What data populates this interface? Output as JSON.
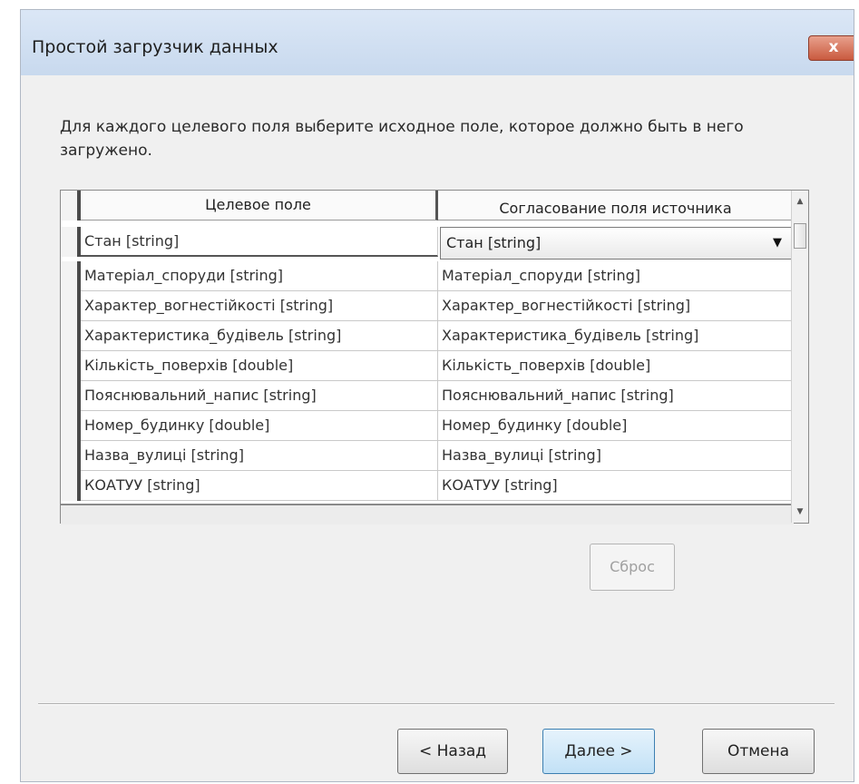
{
  "window": {
    "title": "Простой загрузчик данных",
    "close_label": "x"
  },
  "instructions": "Для каждого целевого поля выберите исходное поле, которое должно быть в него загружено.",
  "grid": {
    "columns": [
      "Целевое поле",
      "Согласование поля источника"
    ],
    "selected_row": {
      "target": "Стан [string]",
      "source_dropdown_value": "Стан [string]"
    },
    "rows": [
      {
        "target": "Матеріал_споруди [string]",
        "source": "Матеріал_споруди [string]"
      },
      {
        "target": "Характер_вогнестійкості [string]",
        "source": "Характер_вогнестійкості [string]"
      },
      {
        "target": "Характеристика_будівель [string]",
        "source": "Характеристика_будівель [string]"
      },
      {
        "target": "Кількість_поверхів [double]",
        "source": "Кількість_поверхів [double]"
      },
      {
        "target": "Пояснювальний_напис [string]",
        "source": "Пояснювальний_напис [string]"
      },
      {
        "target": "Номер_будинку [double]",
        "source": "Номер_будинку [double]"
      },
      {
        "target": "Назва_вулиці [string]",
        "source": "Назва_вулиці [string]"
      },
      {
        "target": "КОАТУУ [string]",
        "source": "КОАТУУ [string]"
      }
    ]
  },
  "buttons": {
    "reset": "Сброс",
    "back": "< Назад",
    "next": "Далее >",
    "cancel": "Отмена"
  },
  "icons": {
    "dropdown": "chevron-down-icon",
    "scroll_up": "arrow-up-icon",
    "scroll_down": "arrow-down-icon"
  }
}
